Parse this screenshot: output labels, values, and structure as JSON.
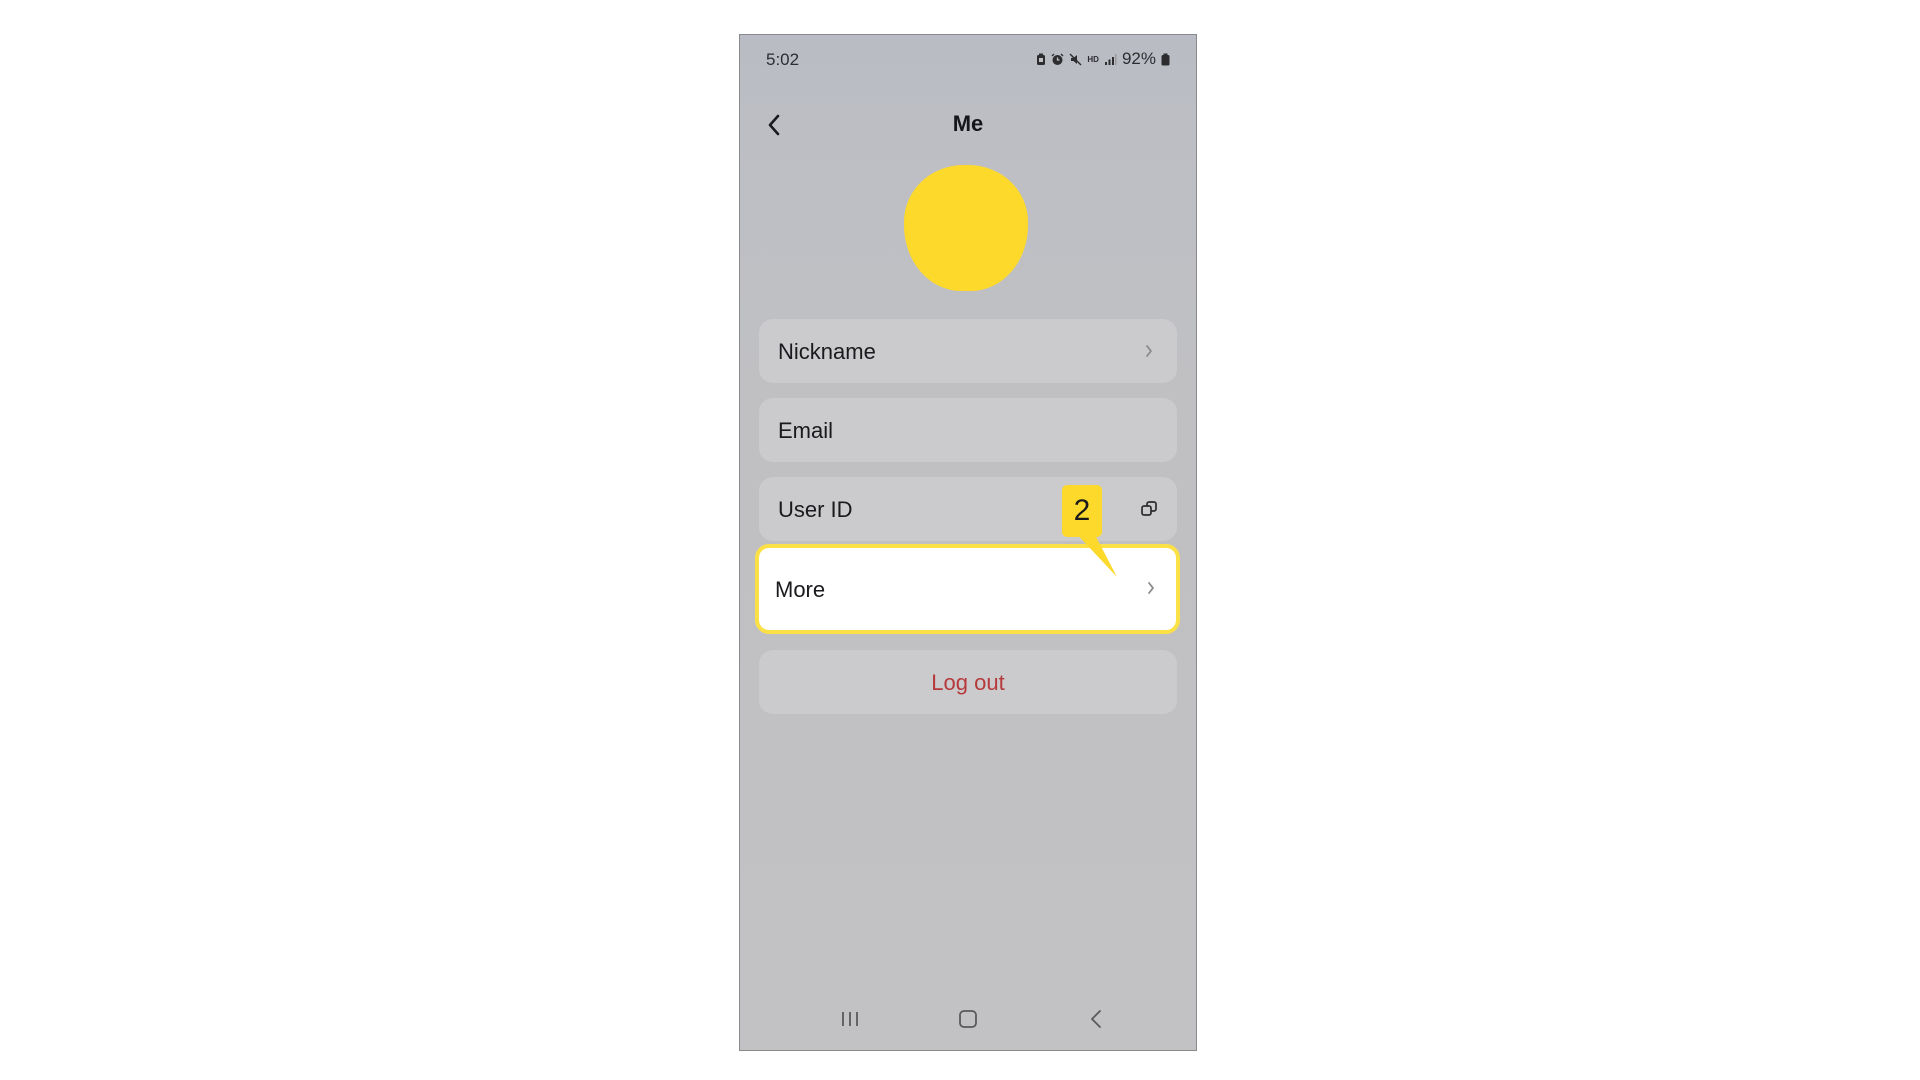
{
  "status_bar": {
    "time": "5:02",
    "battery": "92%",
    "icons": [
      "battery-saver-icon",
      "alarm-icon",
      "mute-icon",
      "hd-voice-icon",
      "signal-icon",
      "battery-icon"
    ],
    "hd_label": "HD"
  },
  "app_bar": {
    "title": "Me",
    "back_icon": "chevron-left-icon"
  },
  "profile": {
    "avatar_color": "#fdd92b"
  },
  "settings": {
    "nickname_label": "Nickname",
    "email_label": "Email",
    "user_id_label": "User ID",
    "more_label": "More",
    "logout_label": "Log out",
    "chevron_icon": "chevron-right-icon",
    "copy_icon": "copy-icon"
  },
  "annotation": {
    "step_number": "2",
    "highlight_color": "#fbe046"
  },
  "nav_bar": {
    "recents_icon": "recents-icon",
    "home_icon": "home-icon",
    "back_icon": "back-icon"
  },
  "colors": {
    "logout_text": "#b63a3c",
    "row_background": "#cbcbcd",
    "screen_background": "#c0c0c3"
  }
}
